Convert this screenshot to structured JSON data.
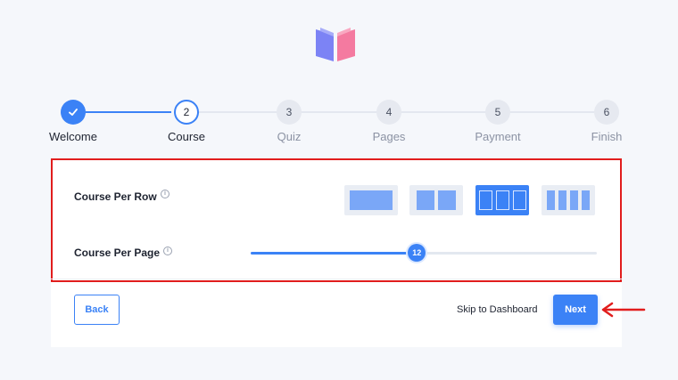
{
  "wizard": {
    "steps": [
      {
        "number": "1",
        "label": "Welcome",
        "state": "completed"
      },
      {
        "number": "2",
        "label": "Course",
        "state": "current"
      },
      {
        "number": "3",
        "label": "Quiz",
        "state": "pending"
      },
      {
        "number": "4",
        "label": "Pages",
        "state": "pending"
      },
      {
        "number": "5",
        "label": "Payment",
        "state": "pending"
      },
      {
        "number": "6",
        "label": "Finish",
        "state": "pending"
      }
    ]
  },
  "settings": {
    "per_row": {
      "label": "Course Per Row",
      "info": "i",
      "options": [
        {
          "icon": "one-column-layout-icon",
          "columns": 1
        },
        {
          "icon": "two-column-layout-icon",
          "columns": 2
        },
        {
          "icon": "three-column-layout-icon",
          "columns": 3
        },
        {
          "icon": "four-column-layout-icon",
          "columns": 4
        }
      ],
      "selected_columns": 3
    },
    "per_page": {
      "label": "Course Per Page",
      "info": "i",
      "value": "12",
      "fill_fraction": 0.48
    }
  },
  "footer": {
    "back_label": "Back",
    "skip_label": "Skip to Dashboard",
    "next_label": "Next"
  },
  "colors": {
    "accent": "#3b82f6",
    "highlight_border": "#e11d1d",
    "arrow": "#e11d1d",
    "logo_left": "#7c83f5",
    "logo_right": "#f47aa0"
  }
}
